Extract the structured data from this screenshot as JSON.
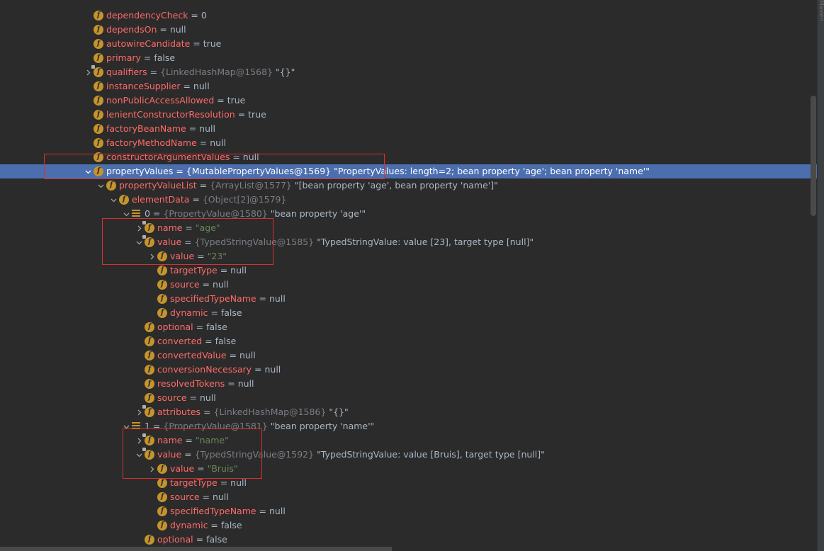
{
  "side_strip_label": "Maven",
  "rows": [
    {
      "depth": 0,
      "expand": "none",
      "icon": "field",
      "lock": false,
      "name": "dependencyCheck",
      "value": "0"
    },
    {
      "depth": 0,
      "expand": "none",
      "icon": "field",
      "lock": false,
      "name": "dependsOn",
      "value": "null"
    },
    {
      "depth": 0,
      "expand": "none",
      "icon": "field",
      "lock": false,
      "name": "autowireCandidate",
      "value": "true"
    },
    {
      "depth": 0,
      "expand": "none",
      "icon": "field",
      "lock": false,
      "name": "primary",
      "value": "false"
    },
    {
      "depth": 0,
      "expand": "collapsed",
      "icon": "field",
      "lock": true,
      "name": "qualifiers",
      "type": "{LinkedHashMap@1568}",
      "value": "\"{}\""
    },
    {
      "depth": 0,
      "expand": "none",
      "icon": "field",
      "lock": false,
      "name": "instanceSupplier",
      "value": "null"
    },
    {
      "depth": 0,
      "expand": "none",
      "icon": "field",
      "lock": false,
      "name": "nonPublicAccessAllowed",
      "value": "true"
    },
    {
      "depth": 0,
      "expand": "none",
      "icon": "field",
      "lock": false,
      "name": "lenientConstructorResolution",
      "value": "true"
    },
    {
      "depth": 0,
      "expand": "none",
      "icon": "field",
      "lock": false,
      "name": "factoryBeanName",
      "value": "null"
    },
    {
      "depth": 0,
      "expand": "none",
      "icon": "field",
      "lock": false,
      "name": "factoryMethodName",
      "value": "null"
    },
    {
      "depth": 0,
      "expand": "none",
      "icon": "field",
      "lock": false,
      "name": "constructorArgumentValues",
      "value": "null"
    },
    {
      "depth": 0,
      "expand": "expanded",
      "icon": "field",
      "lock": false,
      "selected": true,
      "name": "propertyValues",
      "type": "{MutablePropertyValues@1569}",
      "value": "\"PropertyValues: length=2; bean property 'age'; bean property 'name'\""
    },
    {
      "depth": 1,
      "expand": "expanded",
      "icon": "field",
      "lock": false,
      "name": "propertyValueList",
      "type": "{ArrayList@1577}",
      "value": "\"[bean property 'age', bean property 'name']\""
    },
    {
      "depth": 2,
      "expand": "expanded",
      "icon": "field",
      "lock": false,
      "name": "elementData",
      "type": "{Object[2]@1579}",
      "value": ""
    },
    {
      "depth": 3,
      "expand": "expanded",
      "icon": "array",
      "lock": false,
      "index": true,
      "name": "0",
      "type": "{PropertyValue@1580}",
      "value": "\"bean property 'age'\""
    },
    {
      "depth": 4,
      "expand": "collapsed",
      "icon": "field",
      "lock": true,
      "name": "name",
      "str": "\"age\""
    },
    {
      "depth": 4,
      "expand": "expanded",
      "icon": "field",
      "lock": true,
      "name": "value",
      "type": "{TypedStringValue@1585}",
      "value": "\"TypedStringValue: value [23], target type [null]\""
    },
    {
      "depth": 5,
      "expand": "collapsed",
      "icon": "field",
      "lock": false,
      "name": "value",
      "str": "\"23\""
    },
    {
      "depth": 5,
      "expand": "none",
      "icon": "field",
      "lock": false,
      "name": "targetType",
      "value": "null"
    },
    {
      "depth": 5,
      "expand": "none",
      "icon": "field",
      "lock": false,
      "name": "source",
      "value": "null"
    },
    {
      "depth": 5,
      "expand": "none",
      "icon": "field",
      "lock": false,
      "name": "specifiedTypeName",
      "value": "null"
    },
    {
      "depth": 5,
      "expand": "none",
      "icon": "field",
      "lock": false,
      "name": "dynamic",
      "value": "false"
    },
    {
      "depth": 4,
      "expand": "none",
      "icon": "field",
      "lock": false,
      "name": "optional",
      "value": "false"
    },
    {
      "depth": 4,
      "expand": "none",
      "icon": "field",
      "lock": false,
      "name": "converted",
      "value": "false"
    },
    {
      "depth": 4,
      "expand": "none",
      "icon": "field",
      "lock": false,
      "name": "convertedValue",
      "value": "null"
    },
    {
      "depth": 4,
      "expand": "none",
      "icon": "field",
      "lock": false,
      "name": "conversionNecessary",
      "value": "null"
    },
    {
      "depth": 4,
      "expand": "none",
      "icon": "field",
      "lock": false,
      "name": "resolvedTokens",
      "value": "null"
    },
    {
      "depth": 4,
      "expand": "none",
      "icon": "field",
      "lock": false,
      "name": "source",
      "value": "null"
    },
    {
      "depth": 4,
      "expand": "collapsed",
      "icon": "field",
      "lock": true,
      "name": "attributes",
      "type": "{LinkedHashMap@1586}",
      "value": "\"{}\""
    },
    {
      "depth": 3,
      "expand": "expanded",
      "icon": "array",
      "lock": false,
      "index": true,
      "name": "1",
      "type": "{PropertyValue@1581}",
      "value": "\"bean property 'name'\""
    },
    {
      "depth": 4,
      "expand": "collapsed",
      "icon": "field",
      "lock": true,
      "name": "name",
      "str": "\"name\""
    },
    {
      "depth": 4,
      "expand": "expanded",
      "icon": "field",
      "lock": true,
      "name": "value",
      "type": "{TypedStringValue@1592}",
      "value": "\"TypedStringValue: value [Bruis], target type [null]\""
    },
    {
      "depth": 5,
      "expand": "collapsed",
      "icon": "field",
      "lock": false,
      "name": "value",
      "str": "\"Bruis\""
    },
    {
      "depth": 5,
      "expand": "none",
      "icon": "field",
      "lock": false,
      "name": "targetType",
      "value": "null"
    },
    {
      "depth": 5,
      "expand": "none",
      "icon": "field",
      "lock": false,
      "name": "source",
      "value": "null"
    },
    {
      "depth": 5,
      "expand": "none",
      "icon": "field",
      "lock": false,
      "name": "specifiedTypeName",
      "value": "null"
    },
    {
      "depth": 5,
      "expand": "none",
      "icon": "field",
      "lock": false,
      "name": "dynamic",
      "value": "false"
    },
    {
      "depth": 4,
      "expand": "none",
      "icon": "field",
      "lock": false,
      "name": "optional",
      "value": "false"
    }
  ]
}
